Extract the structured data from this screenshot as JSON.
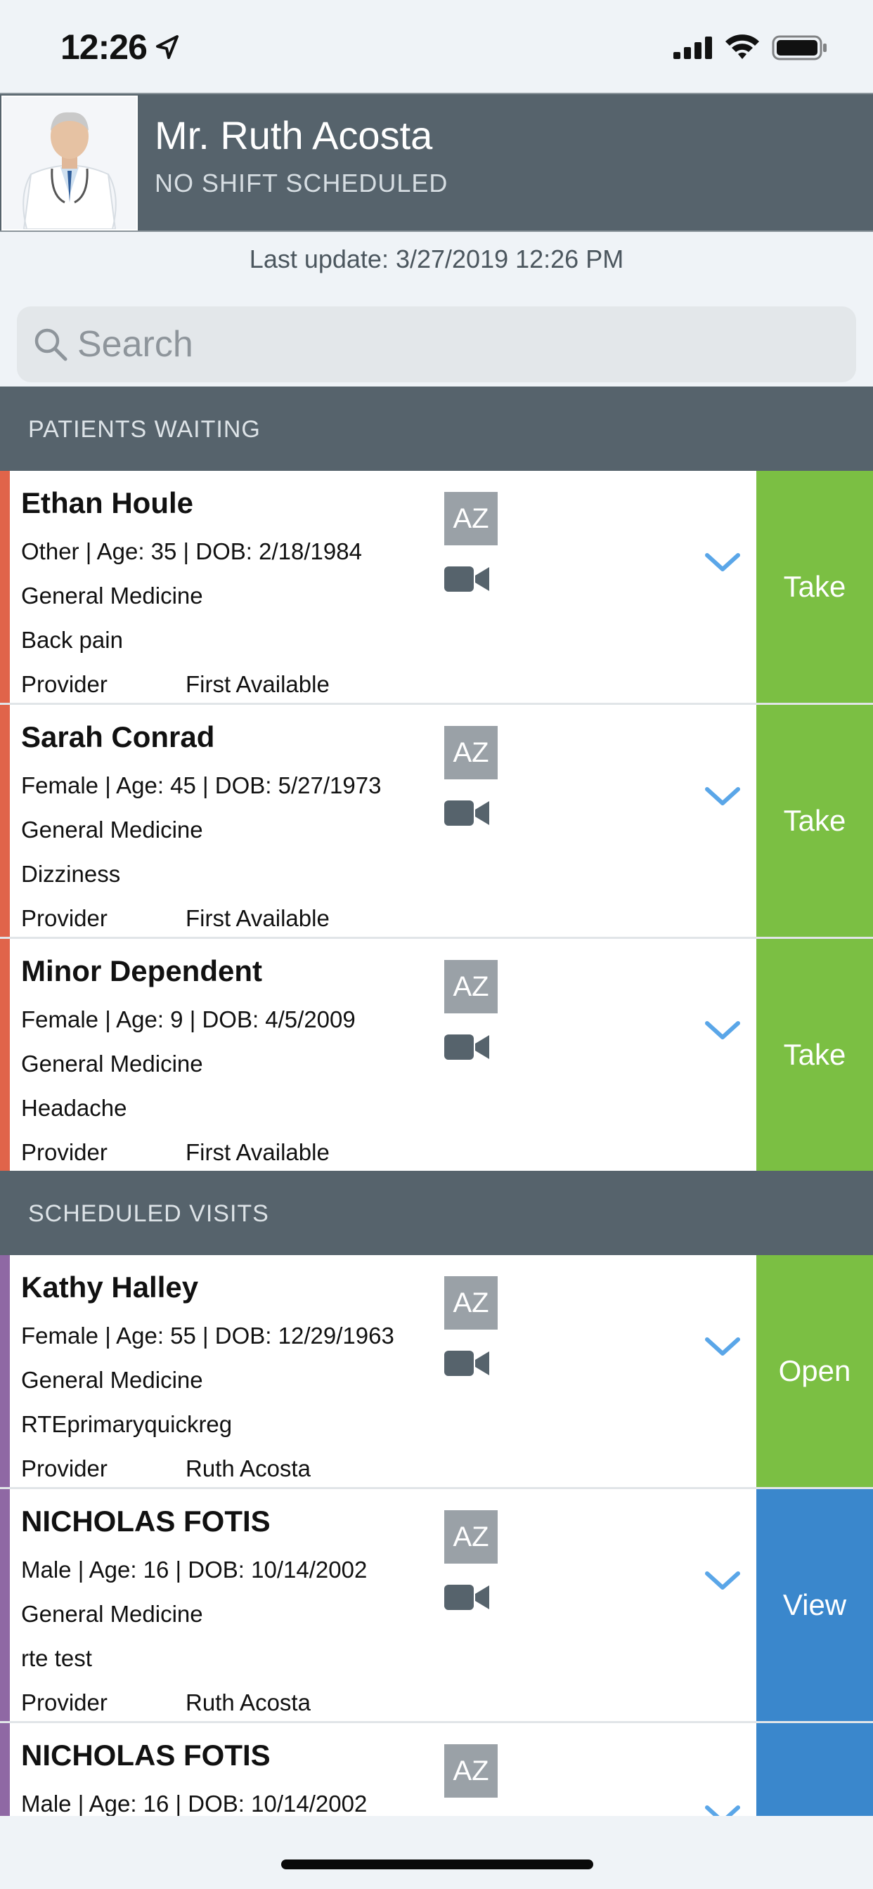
{
  "status_bar": {
    "time": "12:26"
  },
  "header": {
    "doctor_name": "Mr. Ruth Acosta",
    "shift_status": "NO SHIFT SCHEDULED"
  },
  "last_update": "Last update: 3/27/2019 12:26 PM",
  "search": {
    "placeholder": "Search"
  },
  "sections": {
    "waiting": {
      "title": "PATIENTS WAITING"
    },
    "scheduled": {
      "title": "SCHEDULED VISITS"
    }
  },
  "patients": [
    {
      "name": "Ethan Houle",
      "demographics": "Other | Age: 35 | DOB: 2/18/1984",
      "specialty": "General Medicine",
      "reason": "Back pain",
      "provider_label": "Provider",
      "provider": "First Available",
      "badge": "AZ",
      "action": "Take"
    },
    {
      "name": "Sarah Conrad",
      "demographics": "Female | Age: 45 | DOB: 5/27/1973",
      "specialty": "General Medicine",
      "reason": "Dizziness",
      "provider_label": "Provider",
      "provider": "First Available",
      "badge": "AZ",
      "action": "Take"
    },
    {
      "name": "Minor Dependent",
      "demographics": "Female | Age: 9 | DOB: 4/5/2009",
      "specialty": "General Medicine",
      "reason": "Headache",
      "provider_label": "Provider",
      "provider": "First Available",
      "badge": "AZ",
      "action": "Take"
    },
    {
      "name": "Kathy Halley",
      "demographics": "Female | Age: 55 | DOB: 12/29/1963",
      "specialty": "General Medicine",
      "reason": "RTEprimaryquickreg",
      "provider_label": "Provider",
      "provider": "Ruth Acosta",
      "badge": "AZ",
      "action": "Open"
    },
    {
      "name": "NICHOLAS FOTIS",
      "demographics": "Male | Age: 16 | DOB: 10/14/2002",
      "specialty": "General Medicine",
      "reason": "rte test",
      "provider_label": "Provider",
      "provider": "Ruth Acosta",
      "badge": "AZ",
      "action": "View"
    },
    {
      "name": "NICHOLAS FOTIS",
      "demographics": "Male | Age: 16 | DOB: 10/14/2002",
      "badge": "AZ"
    }
  ],
  "colors": {
    "header_bg": "#56636c",
    "waiting_accent": "#e0644a",
    "scheduled_accent": "#8f68a4",
    "take_green": "#7bbf43",
    "view_blue": "#3a87cc",
    "chevron_blue": "#5aa6e8"
  },
  "icons": [
    "location-arrow-icon",
    "signal-icon",
    "wifi-icon",
    "battery-icon",
    "search-icon",
    "video-camera-icon",
    "chevron-down-icon"
  ]
}
